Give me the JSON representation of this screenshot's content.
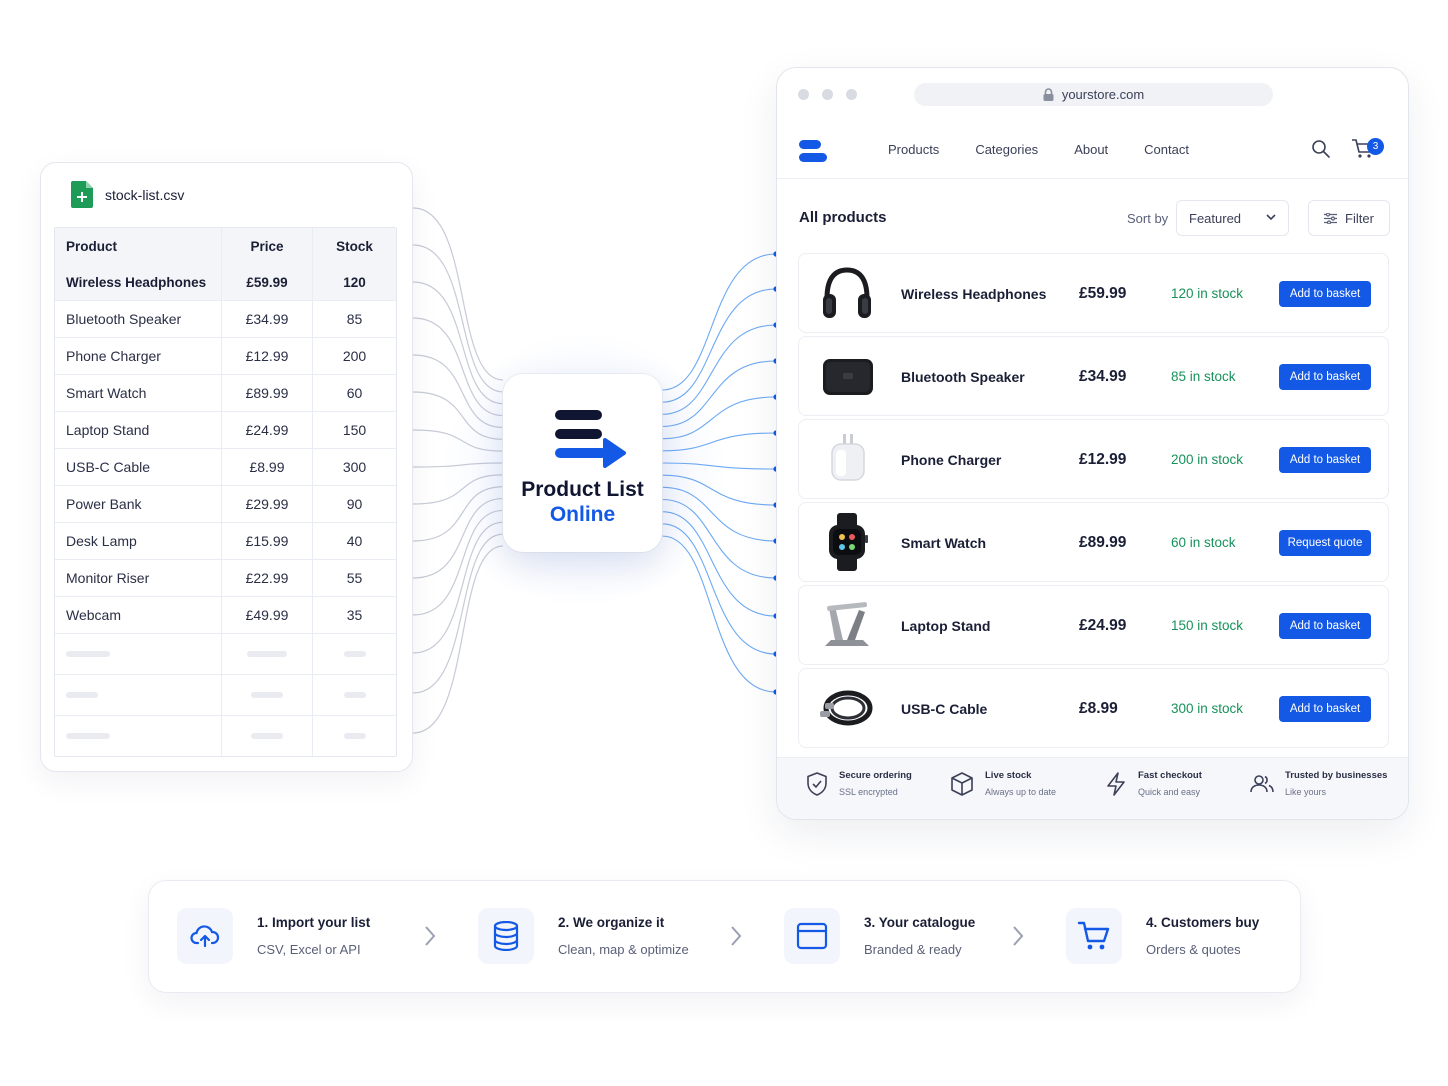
{
  "spreadsheet": {
    "filename": "stock-list.csv",
    "headers": [
      "Product",
      "Price",
      "Stock"
    ],
    "rows": [
      [
        "Wireless Headphones",
        "£59.99",
        "120"
      ],
      [
        "Bluetooth Speaker",
        "£34.99",
        "85"
      ],
      [
        "Phone Charger",
        "£12.99",
        "200"
      ],
      [
        "Smart Watch",
        "£89.99",
        "60"
      ],
      [
        "Laptop Stand",
        "£24.99",
        "150"
      ],
      [
        "USB-C Cable",
        "£8.99",
        "300"
      ],
      [
        "Power Bank",
        "£29.99",
        "90"
      ],
      [
        "Desk Lamp",
        "£15.99",
        "40"
      ],
      [
        "Monitor Riser",
        "£22.99",
        "55"
      ],
      [
        "Webcam",
        "£49.99",
        "35"
      ]
    ]
  },
  "hub": {
    "title_line1": "Product List",
    "title_line2": "Online"
  },
  "browser": {
    "url": "yourstore.com",
    "nav": [
      "Products",
      "Categories",
      "About",
      "Contact"
    ],
    "cart_count": "3",
    "list_title": "All products",
    "sort_label": "Sort by",
    "sort_value": "Featured",
    "filter_label": "Filter",
    "products": [
      {
        "name": "Wireless Headphones",
        "price": "£59.99",
        "stock": "120 in stock",
        "button": "Add to basket",
        "icon": "headphones-icon"
      },
      {
        "name": "Bluetooth Speaker",
        "price": "£34.99",
        "stock": "85 in stock",
        "button": "Add to basket",
        "icon": "speaker-icon"
      },
      {
        "name": "Phone Charger",
        "price": "£12.99",
        "stock": "200 in stock",
        "button": "Add to basket",
        "icon": "charger-icon"
      },
      {
        "name": "Smart Watch",
        "price": "£89.99",
        "stock": "60 in stock",
        "button": "Request quote",
        "icon": "smartwatch-icon"
      },
      {
        "name": "Laptop Stand",
        "price": "£24.99",
        "stock": "150 in stock",
        "button": "Add to basket",
        "icon": "laptop-stand-icon"
      },
      {
        "name": "USB-C Cable",
        "price": "£8.99",
        "stock": "300 in stock",
        "button": "Add to basket",
        "icon": "cable-icon"
      }
    ],
    "trust": [
      {
        "title": "Secure ordering",
        "sub": "SSL encrypted",
        "icon": "shield-check-icon"
      },
      {
        "title": "Live stock",
        "sub": "Always up to date",
        "icon": "box-icon"
      },
      {
        "title": "Fast checkout",
        "sub": "Quick and easy",
        "icon": "lightning-icon"
      },
      {
        "title": "Trusted by businesses",
        "sub": "Like yours",
        "icon": "users-icon"
      }
    ]
  },
  "steps": [
    {
      "title": "1. Import your list",
      "sub": "CSV, Excel or API",
      "icon": "cloud-upload-icon"
    },
    {
      "title": "2. We organize it",
      "sub": "Clean, map & optimize",
      "icon": "database-icon"
    },
    {
      "title": "3. Your catalogue",
      "sub": "Branded & ready",
      "icon": "browser-window-icon"
    },
    {
      "title": "4. Customers buy",
      "sub": "Orders & quotes",
      "icon": "cart-icon"
    }
  ],
  "colors": {
    "accent": "#1459e6",
    "dark": "#101632",
    "stock_green": "#17925a",
    "connector_left": "#c7cbd6",
    "connector_right": "#3b8cf0"
  }
}
